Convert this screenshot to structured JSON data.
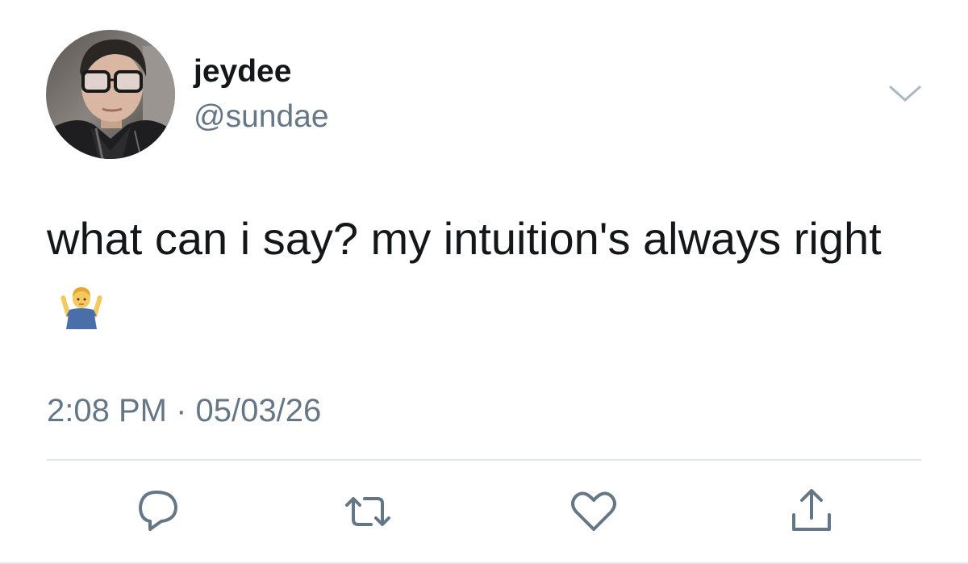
{
  "author": {
    "display_name": "jeydee",
    "handle": "@sundae"
  },
  "tweet": {
    "text": "what can i say? my intuition's always right",
    "emoji": "man-shrugging-emoji",
    "time": "2:08 PM",
    "separator": "·",
    "date": "05/03/26"
  },
  "actions": [
    {
      "name": "reply",
      "icon": "reply-icon"
    },
    {
      "name": "retweet",
      "icon": "retweet-icon"
    },
    {
      "name": "like",
      "icon": "heart-icon"
    },
    {
      "name": "share",
      "icon": "share-icon"
    }
  ],
  "colors": {
    "text": "#14171a",
    "secondary": "#657786",
    "divider": "#e1e8ed"
  }
}
